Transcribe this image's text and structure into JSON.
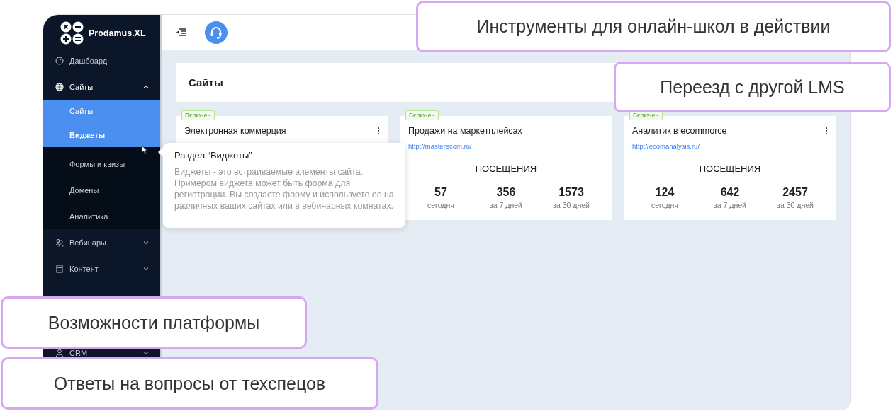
{
  "sidebar": {
    "brand": "Prodamus.XL",
    "items": [
      {
        "label": "Дашбоард",
        "kind": "dashboard"
      },
      {
        "label": "Сайты",
        "kind": "globe",
        "expanded": true,
        "children": [
          {
            "label": "Сайты",
            "selected": true,
            "hovered": false
          },
          {
            "label": "Виджеты",
            "selected": false,
            "hovered": true
          },
          {
            "label": "Формы и квизы",
            "selected": false,
            "hovered": false
          },
          {
            "label": "Домены",
            "selected": false,
            "hovered": false
          },
          {
            "label": "Аналитика",
            "selected": false,
            "hovered": false
          }
        ]
      },
      {
        "label": "Вебинары",
        "kind": "people",
        "expanded": false
      },
      {
        "label": "Контент",
        "kind": "list",
        "expanded": false
      },
      {
        "label": "CRM",
        "kind": "person",
        "expanded": false
      }
    ]
  },
  "header": {
    "title": "Сайты"
  },
  "cards": [
    {
      "status": "Включен",
      "title": "Электронная коммерция",
      "menu": true
    },
    {
      "status": "Включен",
      "title": "Продажи на маркетплейсах",
      "menu": false,
      "url": "http://masterecom.ru/",
      "visits_title": "ПОСЕЩЕНИЯ",
      "stats": [
        {
          "value": "57",
          "label": "сегодня"
        },
        {
          "value": "356",
          "label": "за 7 дней"
        },
        {
          "value": "1573",
          "label": "за 30 дней"
        }
      ]
    },
    {
      "status": "Включен",
      "title": "Аналитик в ecommorce",
      "menu": true,
      "url": "http://ecomanalysis.ru/",
      "visits_title": "ПОСЕЩЕНИЯ",
      "stats": [
        {
          "value": "124",
          "label": "сегодня"
        },
        {
          "value": "642",
          "label": "за 7 дней"
        },
        {
          "value": "2457",
          "label": "за 30 дней"
        }
      ]
    }
  ],
  "tooltip": {
    "title": "Раздел “Виджеты”",
    "text": "Виджеты - это встраиваемые элементы сайта. Примером виджета может быть форма для регистрации. Вы создаете форму и используете ее на различных ваших сайтах или в вебинарных комнатах."
  },
  "callouts": [
    {
      "text": "Инструменты для онлайн-школ в действии"
    },
    {
      "text": "Переезд с другой LMS"
    },
    {
      "text": "Возможности платформы"
    },
    {
      "text": "Ответы на вопросы от техспецов"
    }
  ]
}
